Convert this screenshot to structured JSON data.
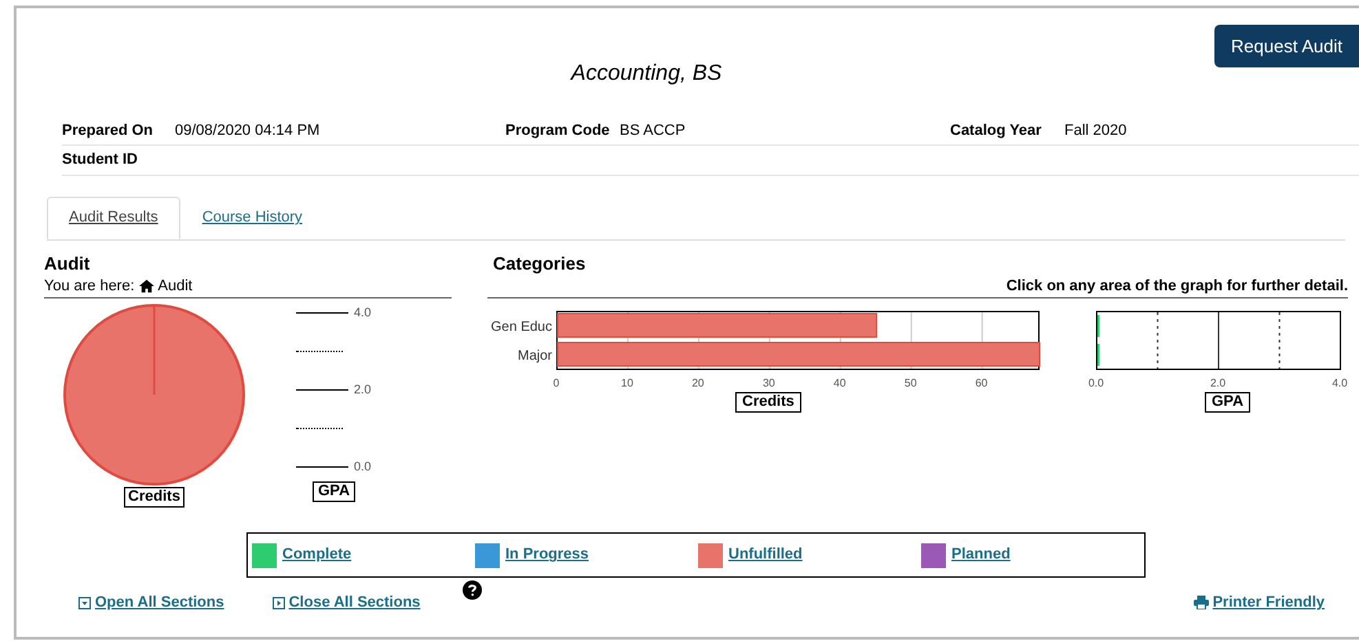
{
  "header": {
    "title": "Accounting, BS",
    "request_button": "Request Audit"
  },
  "info": [
    {
      "label": "Prepared On",
      "value": "09/08/2020 04:14 PM"
    },
    {
      "label": "Program Code",
      "value": "BS ACCP"
    },
    {
      "label": "Catalog Year",
      "value": "Fall 2020"
    },
    {
      "label": "Student ID"
    }
  ],
  "tabs": [
    {
      "label": "Audit Results",
      "selected": true
    },
    {
      "label": "Course History",
      "selected": false
    }
  ],
  "audit": {
    "heading": "Audit",
    "breadcrumb_prefix": "You are here:",
    "breadcrumb": "Audit",
    "pie_label": "Credits",
    "gpa_label": "GPA",
    "gpa_ticks": [
      "4.0",
      "2.0",
      "0.0"
    ]
  },
  "categories": {
    "heading": "Categories",
    "hint": "Click on any area of the graph for further detail.",
    "credits_chart": {
      "chart_data": {
        "type": "bar",
        "orientation": "horizontal",
        "xlabel": "Credits",
        "categories": [
          "Gen Educ",
          "Major"
        ],
        "series": [
          {
            "color": "#e8736a",
            "values": [
              45,
              68
            ]
          }
        ],
        "xlim": [
          0,
          68
        ],
        "xticks": [
          0,
          10,
          20,
          30,
          40,
          50,
          60
        ],
        "grid": true
      }
    },
    "gpa_chart": {
      "label": "GPA",
      "ticks": [
        "0.0",
        "2.0",
        "4.0"
      ]
    }
  },
  "legend": [
    {
      "label": "Complete",
      "color": "#2ecc71"
    },
    {
      "label": "In Progress",
      "color": "#3a98d8"
    },
    {
      "label": "Unfulfilled",
      "color": "#e8736a"
    },
    {
      "label": "Planned",
      "color": "#9b59b6"
    }
  ],
  "footer": {
    "open_all": "Open All Sections",
    "close_all": "Close All Sections",
    "printer": "Printer Friendly"
  }
}
